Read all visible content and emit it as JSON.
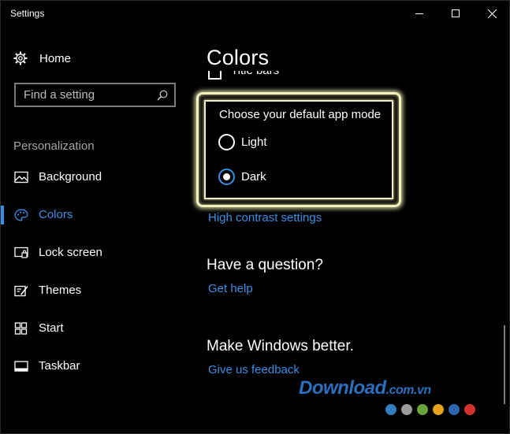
{
  "window": {
    "title": "Settings"
  },
  "sidebar": {
    "home_label": "Home",
    "search_placeholder": "Find a setting",
    "section_label": "Personalization",
    "items": [
      {
        "label": "Background",
        "icon": "picture-icon",
        "active": false
      },
      {
        "label": "Colors",
        "icon": "palette-icon",
        "active": true
      },
      {
        "label": "Lock screen",
        "icon": "lock-screen-icon",
        "active": false
      },
      {
        "label": "Themes",
        "icon": "themes-icon",
        "active": false
      },
      {
        "label": "Start",
        "icon": "start-icon",
        "active": false
      },
      {
        "label": "Taskbar",
        "icon": "taskbar-icon",
        "active": false
      }
    ]
  },
  "main": {
    "title": "Colors",
    "clipped_checkbox_label": "Title bars",
    "app_mode": {
      "label": "Choose your default app mode",
      "options": [
        "Light",
        "Dark"
      ],
      "selected": "Dark"
    },
    "high_contrast_link": "High contrast settings",
    "question_heading": "Have a question?",
    "get_help_link": "Get help",
    "feedback_heading": "Make Windows better.",
    "feedback_link": "Give us feedback"
  },
  "watermark": {
    "text": "Download",
    "suffix": ".com.vn",
    "dot_colors": [
      "#2f7fc1",
      "#9a9a9a",
      "#6aa33a",
      "#e3a21a",
      "#2a66b0",
      "#d3312c"
    ]
  },
  "colors": {
    "accent": "#3a8ee6",
    "background": "#000000",
    "highlight": "#f3f0bf"
  }
}
